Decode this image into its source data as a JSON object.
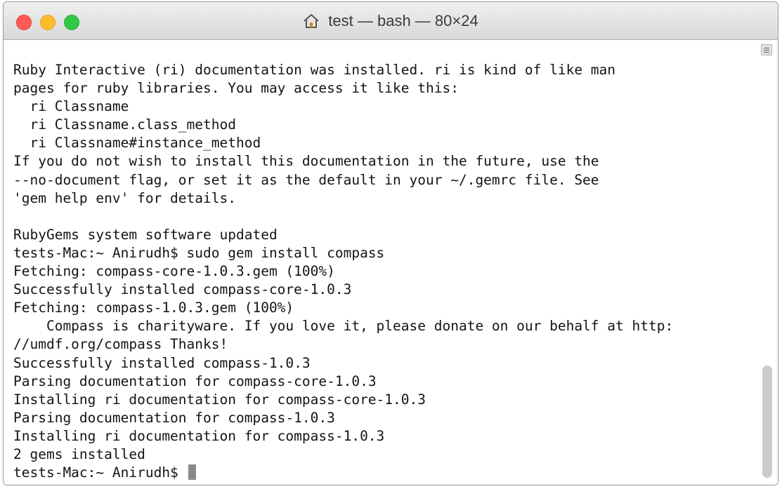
{
  "window": {
    "title": "test — bash — 80×24"
  },
  "terminal": {
    "lines": [
      "Ruby Interactive (ri) documentation was installed. ri is kind of like man",
      "pages for ruby libraries. You may access it like this:",
      "  ri Classname",
      "  ri Classname.class_method",
      "  ri Classname#instance_method",
      "If you do not wish to install this documentation in the future, use the",
      "--no-document flag, or set it as the default in your ~/.gemrc file. See",
      "'gem help env' for details.",
      "",
      "RubyGems system software updated",
      "tests-Mac:~ Anirudh$ sudo gem install compass",
      "Fetching: compass-core-1.0.3.gem (100%)",
      "Successfully installed compass-core-1.0.3",
      "Fetching: compass-1.0.3.gem (100%)",
      "    Compass is charityware. If you love it, please donate on our behalf at http:",
      "//umdf.org/compass Thanks!",
      "Successfully installed compass-1.0.3",
      "Parsing documentation for compass-core-1.0.3",
      "Installing ri documentation for compass-core-1.0.3",
      "Parsing documentation for compass-1.0.3",
      "Installing ri documentation for compass-1.0.3",
      "2 gems installed"
    ],
    "prompt": "tests-Mac:~ Anirudh$ "
  },
  "icons": {
    "title_icon": "home-icon",
    "scroll_grip_icon": "scroll-grip-icon"
  },
  "colors": {
    "close": "#fc5b57",
    "minimize": "#fdbc2e",
    "zoom": "#33c748",
    "text": "#141414",
    "cursor": "#8a8a8a"
  }
}
